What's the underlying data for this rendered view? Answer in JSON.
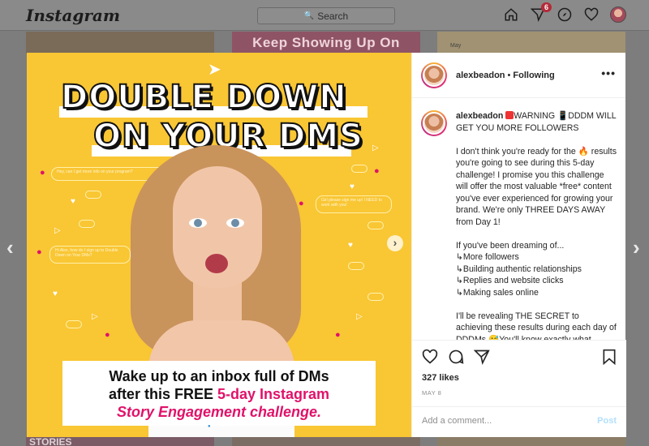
{
  "nav": {
    "logo": "Instagram",
    "search_placeholder": "Search",
    "activity_badge": "6",
    "icons": [
      "home-icon",
      "direct-icon",
      "explore-icon",
      "heart-icon",
      "profile-avatar"
    ]
  },
  "background": {
    "top_middle_text": "Keep Showing Up On",
    "top_right_text": "May",
    "bottom_left_text": "STORIES"
  },
  "post_image": {
    "headline_line1": "DOUBLE DOWN",
    "headline_line2": "ON YOUR DMS",
    "bubbles": [
      "Hey, can I get more info on your program?",
      "Girl please sign me up! I NEED to work with you!",
      "Hi Alex, how do I sign up to Double Down on Your DMs?"
    ],
    "caption_line1": "Wake up to an inbox full of DMs",
    "caption_line2_pre": "after this ",
    "caption_line2_free": "FREE",
    "caption_line2_post": "5-day Instagram",
    "caption_line3": "Story Engagement challenge.",
    "accent_color": "#f9c634",
    "pink_color": "#e0126a"
  },
  "panel": {
    "username": "alexbeadon",
    "separator": "•",
    "following": "Following",
    "more": "•••",
    "caption_user": "alexbeadon",
    "caption_headline": "WARNING 📱DDDM WILL GET YOU MORE FOLLOWERS",
    "para1": "I don't think you're ready for the 🔥 results you're going to see during this 5-day challenge! I promise you this challenge will offer the most valuable *free* content you've ever experienced for growing your brand. We're only THREE DAYS AWAY from Day 1!",
    "para2_intro": "If you've been dreaming of...",
    "list": [
      "More followers",
      "Building authentic relationships",
      "Replies and website clicks",
      "Making sales online"
    ],
    "para3": "I'll be revealing THE SECRET to achieving these results during each day of DDDMs 😅You'll know exactly what",
    "likes": "327 likes",
    "date": "MAY 8",
    "comment_placeholder": "Add a comment...",
    "post_label": "Post"
  }
}
